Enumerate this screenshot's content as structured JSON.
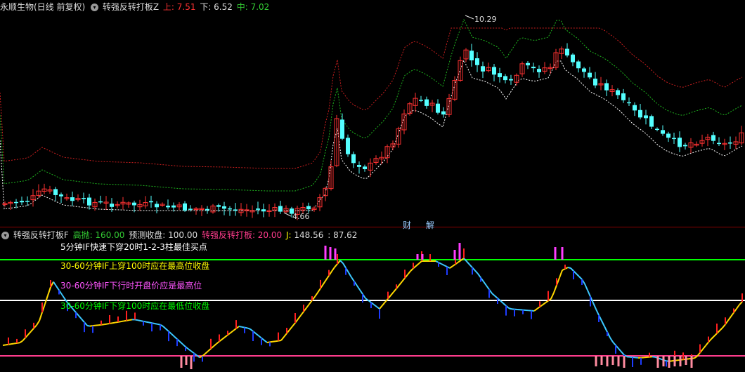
{
  "top_header": {
    "stock_name": "永顺生物(日线 前复权)",
    "indicator_name": "转强反转打板Z",
    "upper_label": "上: ",
    "upper_value": "7.51",
    "lower_label": "下: ",
    "lower_value": "6.52",
    "mid_label": "中: ",
    "mid_value": "7.02"
  },
  "bottom_header": {
    "indicator_name": "转强反转打板F",
    "sell_label": "高抛: ",
    "sell_value": "160.00",
    "forecast_label": "预测收盘: ",
    "forecast_value": "100.00",
    "board_label": "转强反转打板: ",
    "board_value": "20.00",
    "j_label": "J: ",
    "j_value": "148.56",
    "j2_value": ": 87.62"
  },
  "badges": {
    "cai": "财",
    "jie": "解"
  },
  "notes": [
    "5分钟IF快速下穿20时1-2-3柱最佳买点",
    "30-60分钟IF上穿100时应在最高位收盘",
    "30-60分钟IF下行时开盘价应是最高位",
    "30-60分钟IF下穿100时应在最低位收盘"
  ],
  "colors": {
    "up": "#ff3232",
    "down": "#54ffff",
    "upper_band": "#c81e1e",
    "mid_band": "#1eb41e",
    "lower_band": "#ffffff",
    "green_line": "#00ff00",
    "white_line": "#ffffff",
    "pink_line": "#ff3c8c",
    "note_white": "#ffffff",
    "note_yellow": "#ffff00",
    "note_magenta": "#ff55ff",
    "note_green": "#00ff00"
  },
  "chart_data": {
    "type": "candlestick",
    "annotations": {
      "high": "10.29",
      "low": "4.66"
    },
    "bands": {
      "upper": "7.51",
      "lower": "6.52",
      "mid": "7.02"
    },
    "indicator_levels": {
      "green": 160,
      "white": 100,
      "pink": 20
    }
  }
}
